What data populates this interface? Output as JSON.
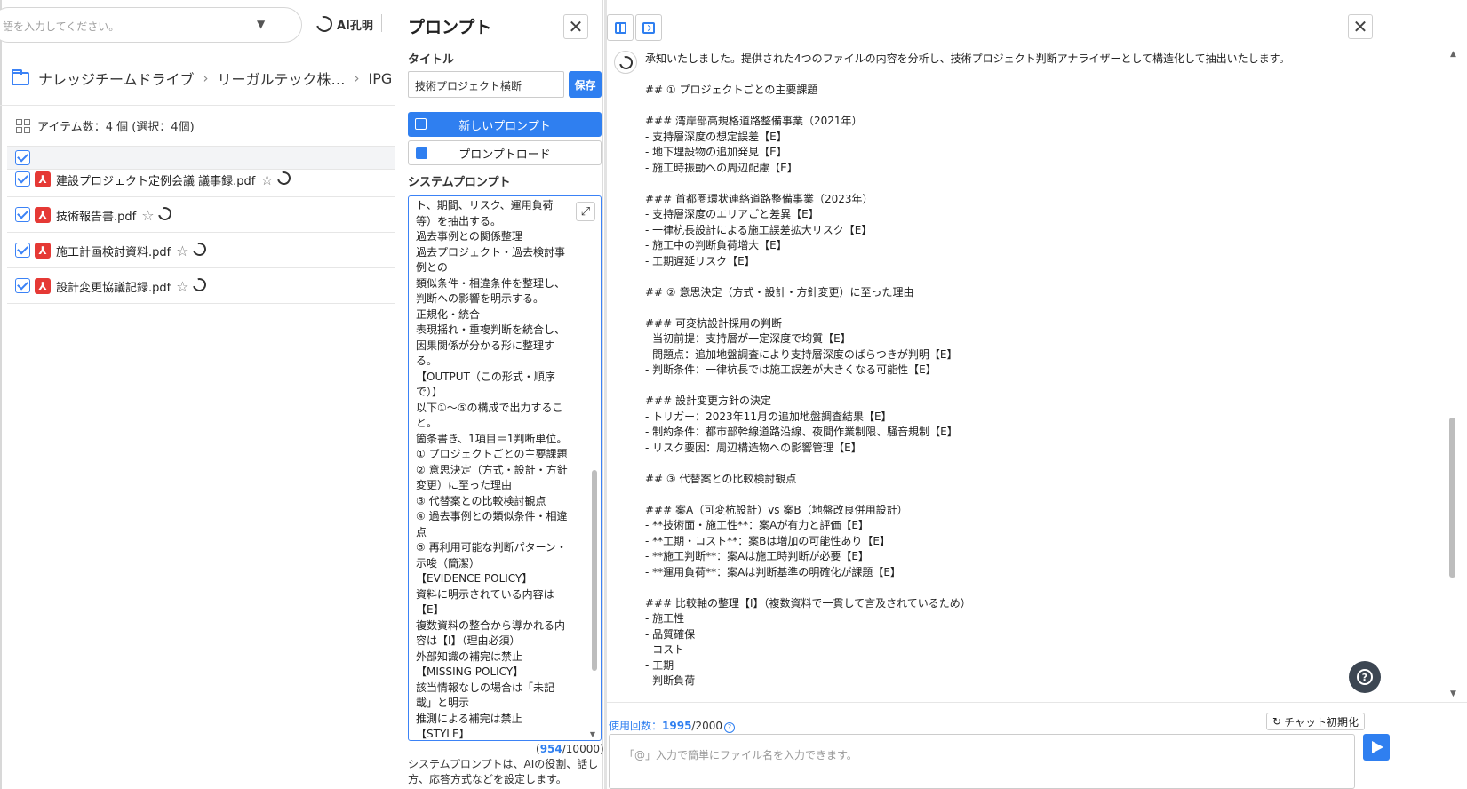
{
  "left": {
    "search_placeholder": "語を入力してください。",
    "ai_label": "AI孔明",
    "breadcrumb": [
      "ナレッジチームドライブ",
      "リーガルテック株…",
      "IPG"
    ],
    "count_label": "アイテム数：4 個 (選択：4個)",
    "files": [
      {
        "name": "建設プロジェクト定例会議 議事録.pdf"
      },
      {
        "name": "技術報告書.pdf"
      },
      {
        "name": "施工計画検討資料.pdf"
      },
      {
        "name": "設計変更協議記録.pdf"
      }
    ]
  },
  "prompt_panel": {
    "title": "プロンプト",
    "title_label": "タイトル",
    "title_value": "技術プロジェクト横断",
    "save_label": "保存",
    "new_prompt_label": "新しいプロンプト",
    "load_prompt_label": "プロンプトロード",
    "system_prompt_label": "システムプロンプト",
    "system_prompt_text": "ト、期間、リスク、運用負荷\n等）を抽出する。\n過去事例との関係整理\n過去プロジェクト・過去検討事\n例との\n類似条件・相違条件を整理し、\n判断への影響を明示する。\n正規化・統合\n表現揺れ・重複判断を統合し、\n因果関係が分かる形に整理す\nる。\n【OUTPUT（この形式・順序\nで）】\n以下①〜⑤の構成で出力するこ\nと。\n箇条書き、1項目＝1判断単位。\n① プロジェクトごとの主要課題\n② 意思決定（方式・設計・方針\n変更）に至った理由\n③ 代替案との比較検討観点\n④ 過去事例との類似条件・相違\n点\n⑤ 再利用可能な判断パターン・\n示唆（簡潔）\n【EVIDENCE POLICY】\n資料に明示されている内容は\n【E】\n複数資料の整合から導かれる内\n容は【I】（理由必須）\n外部知識の補完は禁止\n【MISSING POLICY】\n該当情報なしの場合は「未記\n載」と明示\n推測による補完は禁止\n【STYLE】",
    "char_count": "954",
    "char_max": "/10000)",
    "char_open": "(",
    "help_text": "システムプロンプトは、AIの役割、話し方、応答方式などを設定します。"
  },
  "chat": {
    "response_text": "承知いたしました。提供された4つのファイルの内容を分析し、技術プロジェクト判断アナライザーとして構造化して抽出いたします。\n\n## ① プロジェクトごとの主要課題\n\n### 湾岸部高規格道路整備事業（2021年）\n- 支持層深度の想定誤差【E】\n- 地下埋設物の追加発見【E】\n- 施工時振動への周辺配慮【E】\n\n### 首都圏環状連絡道路整備事業（2023年）\n- 支持層深度のエリアごと差異【E】\n- 一律杭長設計による施工誤差拡大リスク【E】\n- 施工中の判断負荷増大【E】\n- 工期遅延リスク【E】\n\n## ② 意思決定（方式・設計・方針変更）に至った理由\n\n### 可変杭設計採用の判断\n- 当初前提：支持層が一定深度で均質【E】\n- 問題点：追加地盤調査により支持層深度のばらつきが判明【E】\n- 判断条件：一律杭長では施工誤差が大きくなる可能性【E】\n\n### 設計変更方針の決定\n- トリガー：2023年11月の追加地盤調査結果【E】\n- 制約条件：都市部幹線道路沿線、夜間作業制限、騒音規制【E】\n- リスク要因：周辺構造物への影響管理【E】\n\n## ③ 代替案との比較検討観点\n\n### 案A（可変杭設計）vs 案B（地盤改良併用設計）\n- **技術面・施工性**：案Aが有力と評価【E】\n- **工期・コスト**：案Bは増加の可能性あり【E】\n- **施工判断**：案Aは施工時判断が必要【E】\n- **運用負荷**：案Aは判断基準の明確化が課題【E】\n\n### 比較軸の整理【I】（複数資料で一貫して言及されているため）\n- 施工性\n- 品質確保\n- コスト\n- 工期\n- 判断負荷",
    "usage_label": "使用回数：",
    "usage_count": "1995",
    "usage_total": "/2000",
    "reset_label": "チャット初期化",
    "input_placeholder": "「@」入力で簡単にファイル名を入力できます。"
  },
  "colors": {
    "accent": "#2f7ff0",
    "pdf": "#e53935",
    "fab": "#3c4652"
  },
  "icons": [
    "search-caret-icon",
    "ai-swirl-icon",
    "folder-icon",
    "grid-icon",
    "checkbox-icon",
    "pdf-icon",
    "star-icon",
    "close-icon",
    "new-prompt-icon",
    "folder-open-icon",
    "expand-icon",
    "columns-icon",
    "terminal-icon",
    "help-icon",
    "reset-icon",
    "send-icon"
  ]
}
